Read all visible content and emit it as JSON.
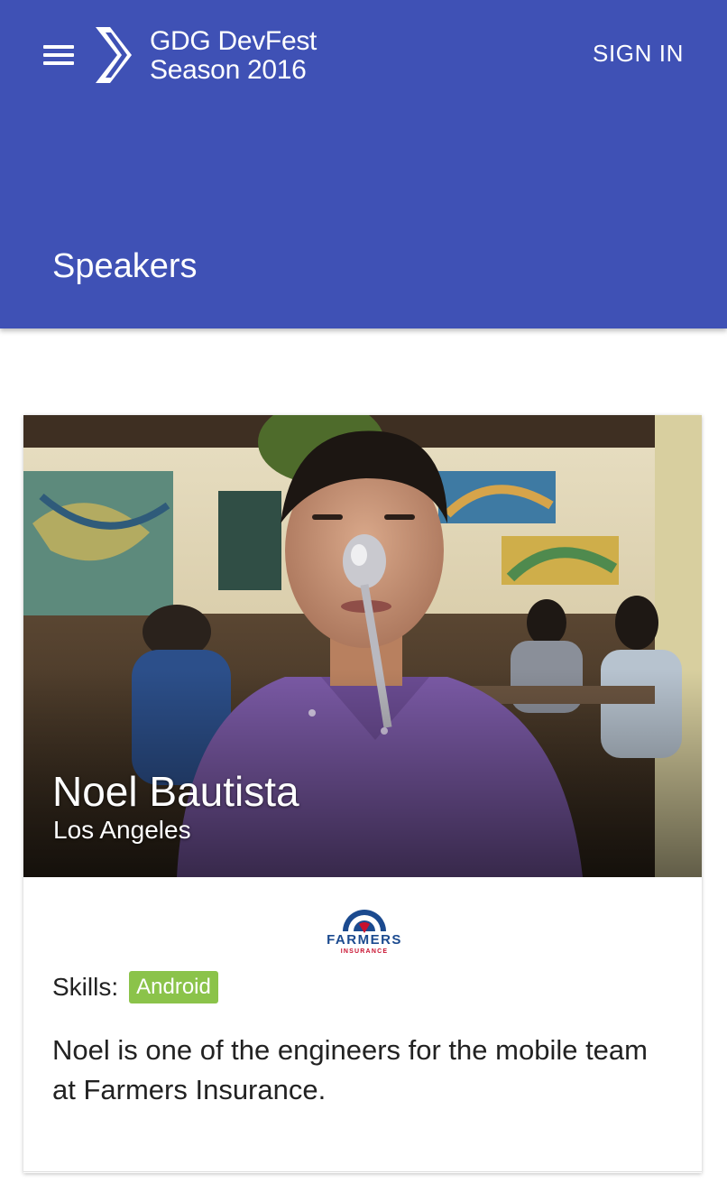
{
  "header": {
    "brand_line1": "GDG DevFest",
    "brand_line2": "Season 2016",
    "sign_in_label": "SIGN IN",
    "page_title": "Speakers",
    "background_color": "#3f51b5"
  },
  "speaker": {
    "name": "Noel Bautista",
    "city": "Los Angeles",
    "company_logo_text": "FARMERS",
    "company_logo_subtext": "INSURANCE",
    "skills_label": "Skills:",
    "skills": [
      "Android"
    ],
    "skill_color": "#8bc34a",
    "bio": "Noel is one of the engineers for the mobile team at Farmers Insurance."
  },
  "icons": {
    "menu": "hamburger-menu-icon",
    "logo": "gdg-chevron-logo-icon"
  }
}
